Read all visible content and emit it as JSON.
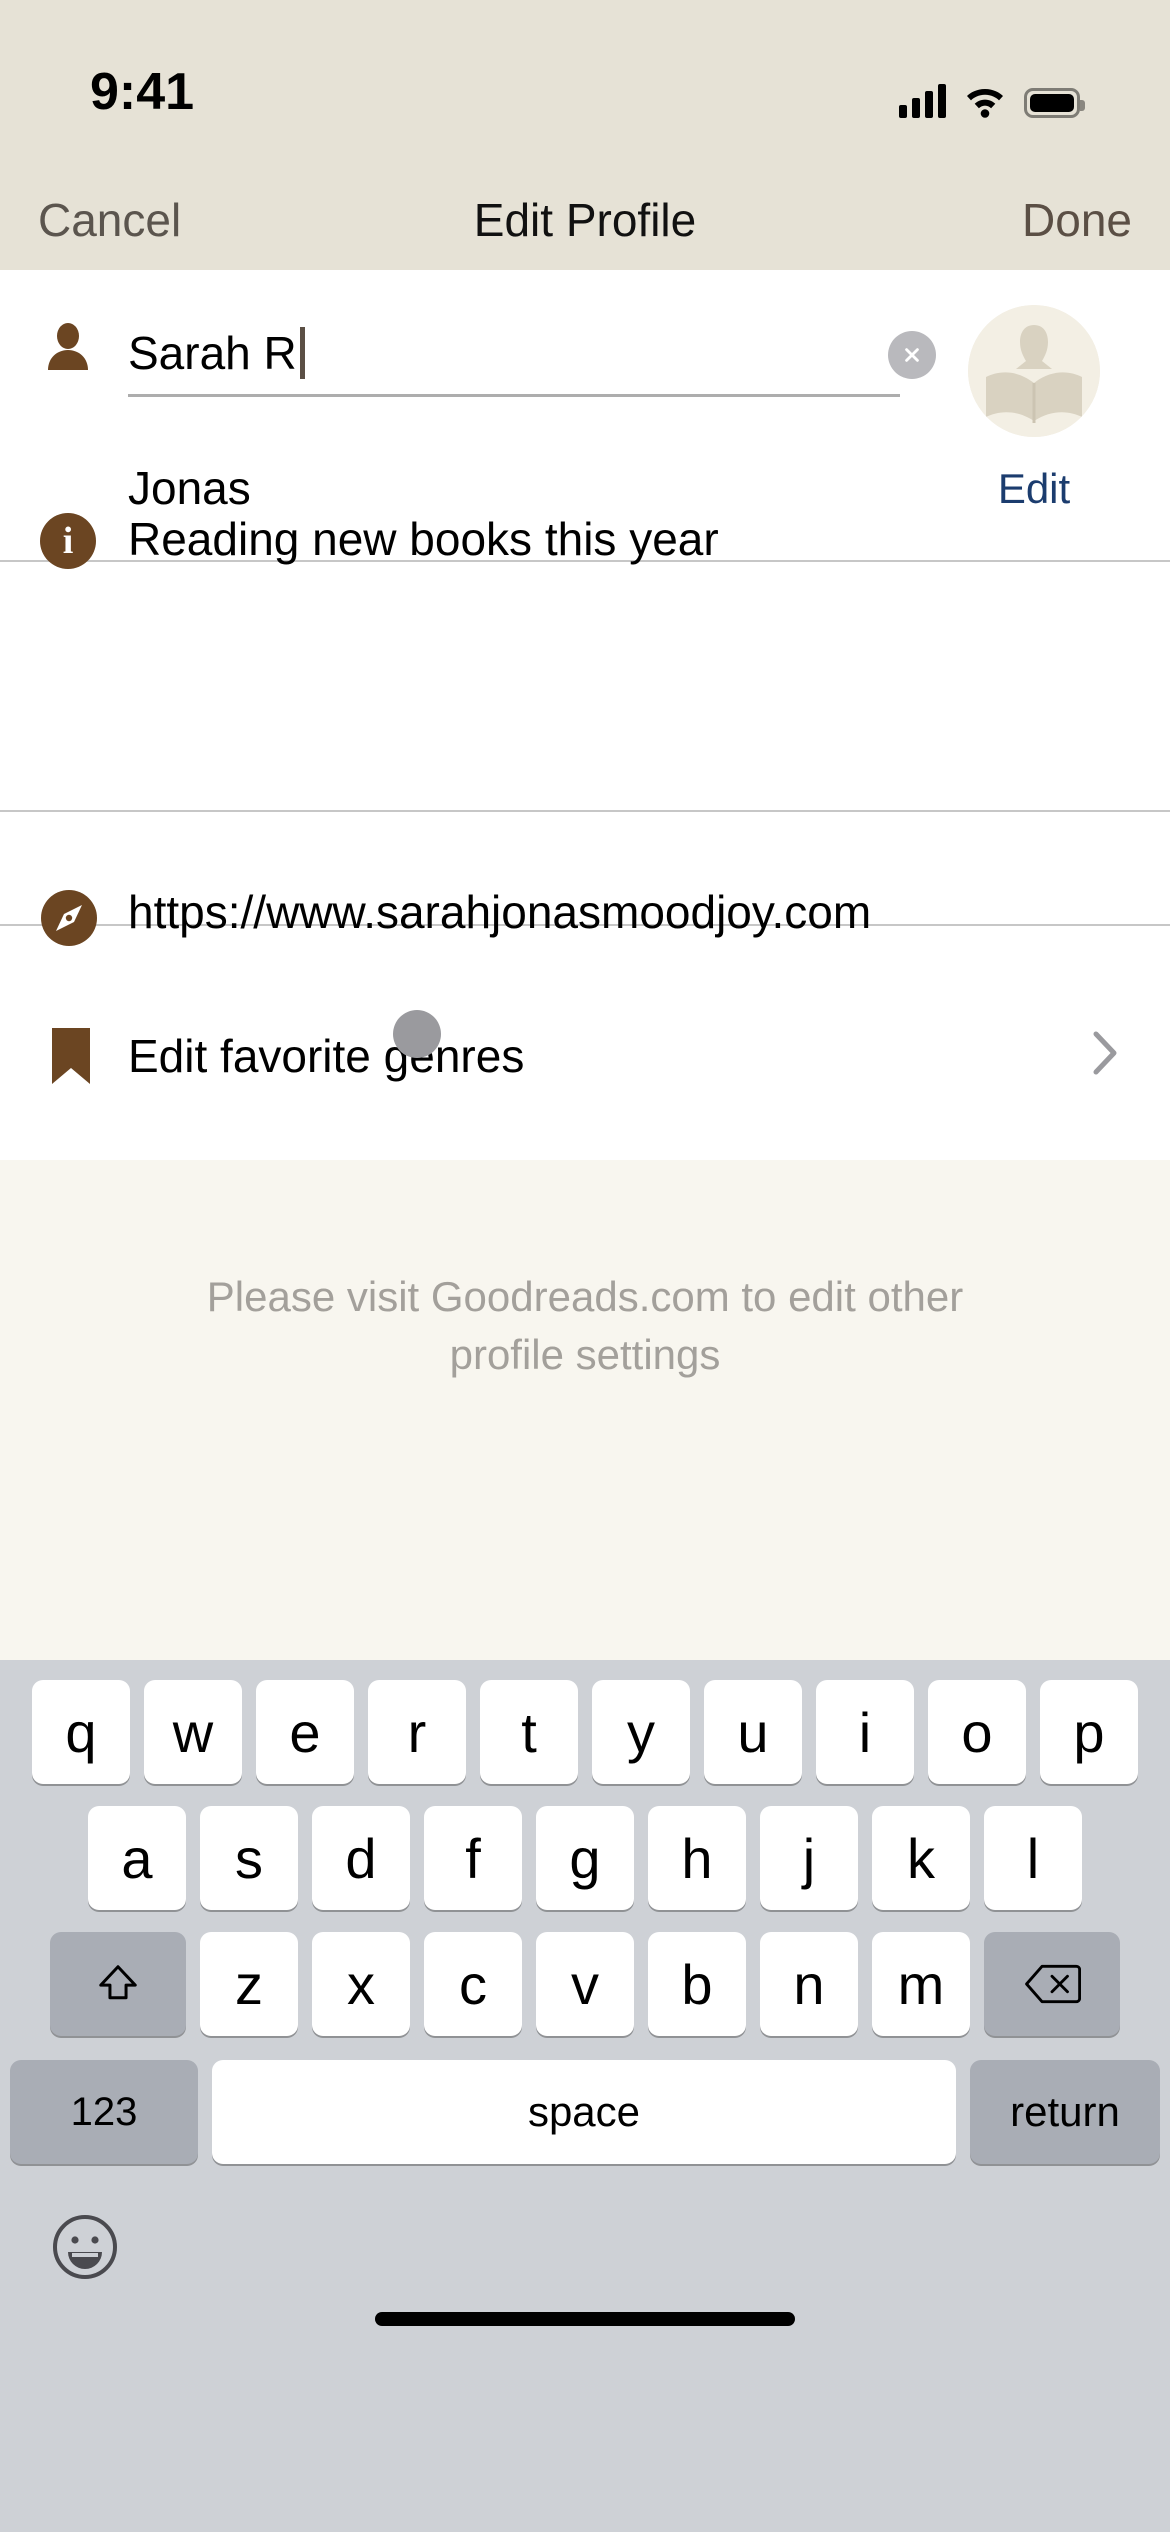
{
  "status_bar": {
    "time": "9:41",
    "cellular_icon": "cellular-bars-icon",
    "wifi_icon": "wifi-icon",
    "battery_icon": "battery-icon"
  },
  "nav_bar": {
    "cancel_label": "Cancel",
    "title": "Edit Profile",
    "done_label": "Done"
  },
  "form": {
    "first_name": {
      "value": "Sarah R",
      "icon": "person-icon",
      "clear_icon": "clear-circle-x-icon",
      "focused": true
    },
    "last_name": {
      "value": "Jonas"
    },
    "avatar": {
      "icon": "reader-avatar-icon",
      "edit_label": "Edit"
    },
    "about": {
      "icon": "info-circle-icon",
      "value": "Reading new books this year"
    },
    "website": {
      "icon": "safari-compass-icon",
      "value": "https://www.sarahjonasmoodjoy.com"
    },
    "genres": {
      "icon": "bookmark-icon",
      "label": "Edit favorite genres",
      "chevron": "chevron-right-icon",
      "touch_indicator": "touch-indicator-dot"
    },
    "footer_note": "Please visit Goodreads.com to edit other profile settings"
  },
  "colors": {
    "nav_background": "#e6e2d6",
    "accent_brown": "#6b4522",
    "done_brown": "#5b4f45",
    "link_blue": "#1b3c6e",
    "footer_background": "#f8f6ef",
    "footer_text": "#a3a09b",
    "keyboard_background": "#ced1d6",
    "key_white": "#ffffff",
    "key_gray": "#a9adb5"
  },
  "keyboard": {
    "row1": [
      "q",
      "w",
      "e",
      "r",
      "t",
      "y",
      "u",
      "i",
      "o",
      "p"
    ],
    "row2": [
      "a",
      "s",
      "d",
      "f",
      "g",
      "h",
      "j",
      "k",
      "l"
    ],
    "row3": [
      "z",
      "x",
      "c",
      "v",
      "b",
      "n",
      "m"
    ],
    "shift_icon": "shift-arrow-icon",
    "backspace_icon": "backspace-delete-icon",
    "numbers_label": "123",
    "space_label": "space",
    "return_label": "return",
    "emoji_icon": "emoji-smiley-icon",
    "home_indicator": "home-indicator-bar"
  }
}
